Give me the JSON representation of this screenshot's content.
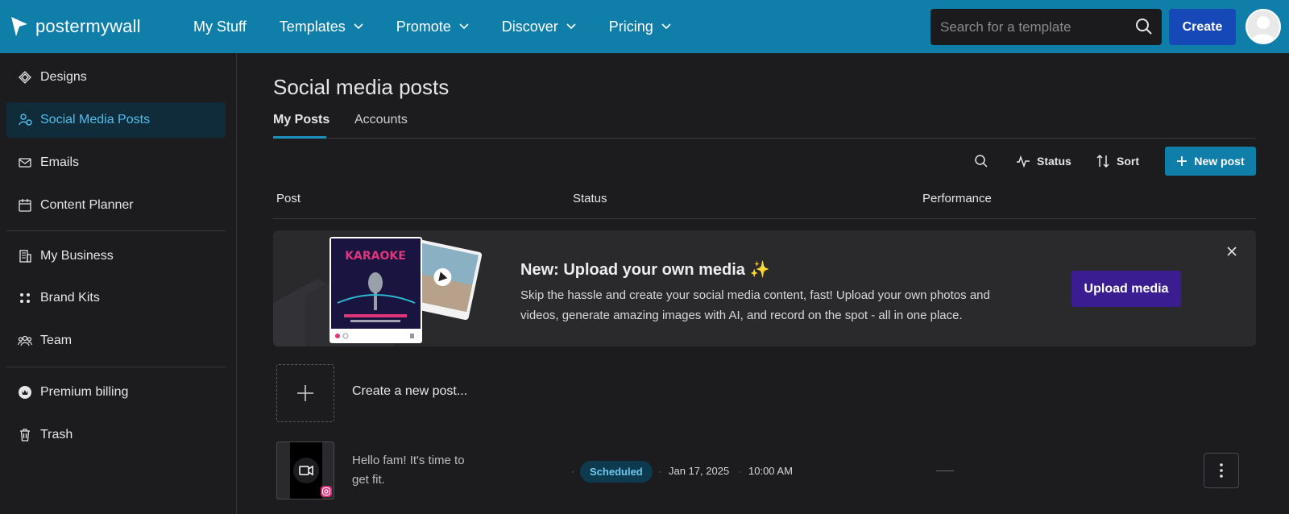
{
  "brand": {
    "name": "postermywall"
  },
  "nav": {
    "items": [
      {
        "label": "My Stuff"
      },
      {
        "label": "Templates"
      },
      {
        "label": "Promote"
      },
      {
        "label": "Discover"
      },
      {
        "label": "Pricing"
      }
    ]
  },
  "search": {
    "placeholder": "Search for a template"
  },
  "header": {
    "create_label": "Create"
  },
  "sidebar": {
    "items": [
      {
        "label": "Designs",
        "icon": "designs-icon"
      },
      {
        "label": "Social Media Posts",
        "icon": "social-posts-icon",
        "active": true
      },
      {
        "label": "Emails",
        "icon": "mail-icon"
      },
      {
        "label": "Content Planner",
        "icon": "calendar-icon"
      },
      {
        "label": "My Business",
        "icon": "business-icon"
      },
      {
        "label": "Brand Kits",
        "icon": "brand-kits-icon"
      },
      {
        "label": "Team",
        "icon": "team-icon"
      },
      {
        "label": "Premium billing",
        "icon": "premium-icon"
      },
      {
        "label": "Trash",
        "icon": "trash-icon"
      }
    ]
  },
  "main": {
    "title": "Social media posts",
    "tabs": [
      {
        "label": "My Posts",
        "active": true
      },
      {
        "label": "Accounts"
      }
    ],
    "toolbar": {
      "status_label": "Status",
      "sort_label": "Sort",
      "new_post_label": "New post"
    },
    "table": {
      "headers": [
        "Post",
        "Status",
        "Performance"
      ]
    },
    "promo": {
      "title": "New: Upload your own media ✨",
      "description": "Skip the hassle and create your social media content, fast! Upload your own photos and videos, generate amazing images with AI, and record on the spot - all in one place.",
      "button_label": "Upload media",
      "poster_text": "KARAOKE"
    },
    "create_row": {
      "label": "Create a new post..."
    },
    "posts": [
      {
        "text": "Hello fam! It's time to get fit.",
        "status": "Scheduled",
        "date": "Jan 17, 2025",
        "time": "10:00 AM",
        "performance": "—"
      }
    ]
  },
  "colors": {
    "topbar": "#0f7ea8",
    "accent": "#4fc0ee",
    "create_button": "#1748b8",
    "upload_button": "#3a1e91",
    "background": "#1c1c1f"
  }
}
